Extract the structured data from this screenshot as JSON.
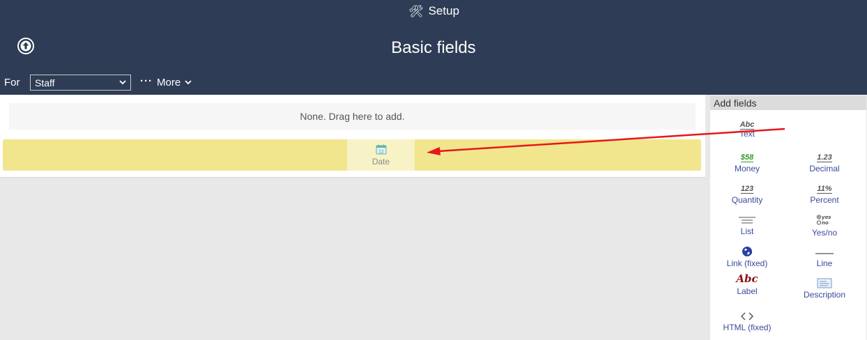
{
  "header": {
    "setup_label": "Setup",
    "title": "Basic fields",
    "for_label": "For",
    "for_select_value": "Staff",
    "more_label": "More"
  },
  "main": {
    "drop_hint": "None. Drag here to add.",
    "dragged_item_label": "Date"
  },
  "sidebar": {
    "heading": "Add fields",
    "fields": [
      {
        "label": "Text",
        "icon": "text-field-icon"
      },
      {
        "label": "Money",
        "icon": "money-field-icon"
      },
      {
        "label": "Decimal",
        "icon": "decimal-field-icon"
      },
      {
        "label": "Quantity",
        "icon": "quantity-field-icon"
      },
      {
        "label": "Percent",
        "icon": "percent-field-icon"
      },
      {
        "label": "List",
        "icon": "list-field-icon"
      },
      {
        "label": "Yes/no",
        "icon": "yes-no-field-icon"
      },
      {
        "label": "Link (fixed)",
        "icon": "link-field-icon"
      },
      {
        "label": "Line",
        "icon": "line-field-icon"
      },
      {
        "label": "Label",
        "icon": "label-field-icon"
      },
      {
        "label": "Description",
        "icon": "description-field-icon"
      },
      {
        "label": "HTML (fixed)",
        "icon": "html-field-icon"
      }
    ],
    "icon_glyphs": {
      "text": "Abc",
      "money": "$58",
      "decimal": "1.23",
      "quantity": "123",
      "percent": "11%",
      "yes": "yes",
      "no": "no",
      "label": "Abc"
    }
  },
  "colors": {
    "header_bg": "#2e3d55",
    "drop_zone": "#f1e68e",
    "link_text": "#3a4a9a",
    "annotation_arrow": "#e8161b"
  }
}
